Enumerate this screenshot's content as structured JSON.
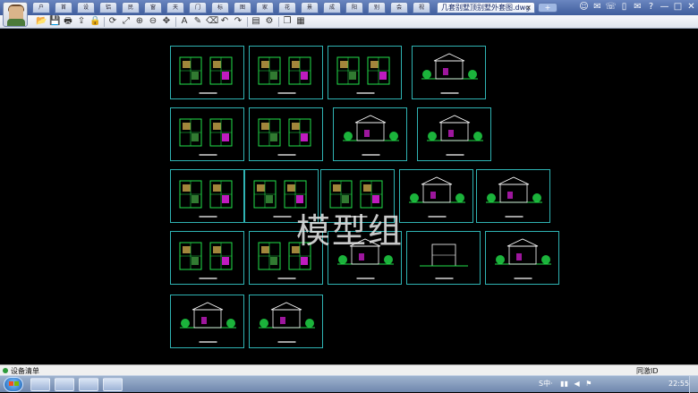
{
  "window": {
    "tabs_short": [
      "户",
      "首",
      "设",
      "铝",
      "民",
      "窗",
      "天",
      "门",
      "标",
      "图",
      "家",
      "花",
      "景",
      "成",
      "阳",
      "别",
      "会",
      "视"
    ],
    "active_tab": "几套别墅顶别墅外套图.dwg",
    "close_glyph": "×",
    "new_tab_glyph": "+"
  },
  "title_icons": [
    "user-icon",
    "chat-icon",
    "message-icon",
    "phone-icon",
    "mail-icon",
    "help-icon",
    "minimize",
    "maximize",
    "close"
  ],
  "title_icon_glyphs": [
    "☺",
    "✉",
    "☏",
    "▯",
    "✉",
    "?",
    "—",
    "□",
    "✕"
  ],
  "toolbar": {
    "buttons": [
      {
        "name": "open-icon",
        "glyph": "📂"
      },
      {
        "name": "save-icon",
        "glyph": "💾"
      },
      {
        "name": "print-icon",
        "glyph": "🖶"
      },
      {
        "name": "export-icon",
        "glyph": "⇪"
      },
      {
        "name": "lock-icon",
        "glyph": "🔒"
      },
      {
        "name": "rotate-icon",
        "glyph": "⟳"
      },
      {
        "name": "zoom-extents-icon",
        "glyph": "⤢"
      },
      {
        "name": "zoom-in-icon",
        "glyph": "⊕"
      },
      {
        "name": "zoom-out-icon",
        "glyph": "⊖"
      },
      {
        "name": "pan-icon",
        "glyph": "✥"
      },
      {
        "name": "text-icon",
        "glyph": "A"
      },
      {
        "name": "pencil-icon",
        "glyph": "✎"
      },
      {
        "name": "eraser-icon",
        "glyph": "⌫"
      },
      {
        "name": "undo-icon",
        "glyph": "↶"
      },
      {
        "name": "redo-icon",
        "glyph": "↷"
      },
      {
        "name": "layers-icon",
        "glyph": "▤"
      },
      {
        "name": "settings-icon",
        "glyph": "⚙"
      },
      {
        "name": "copy-icon",
        "glyph": "❐"
      },
      {
        "name": "layout-icon",
        "glyph": "▦"
      }
    ]
  },
  "canvas": {
    "watermark": "模型组",
    "colors": {
      "frame": "#2fb3b3",
      "plan": "#22e04a",
      "accent": "#e020e0",
      "label": "#ffffff"
    }
  },
  "statusbar": {
    "command_label": "设备清单",
    "right_label": "同激ID"
  },
  "taskbar": {
    "apps": [
      "app-1",
      "app-2",
      "app-3",
      "app-4"
    ],
    "tray_text": "S中·",
    "clock": "22:55"
  }
}
